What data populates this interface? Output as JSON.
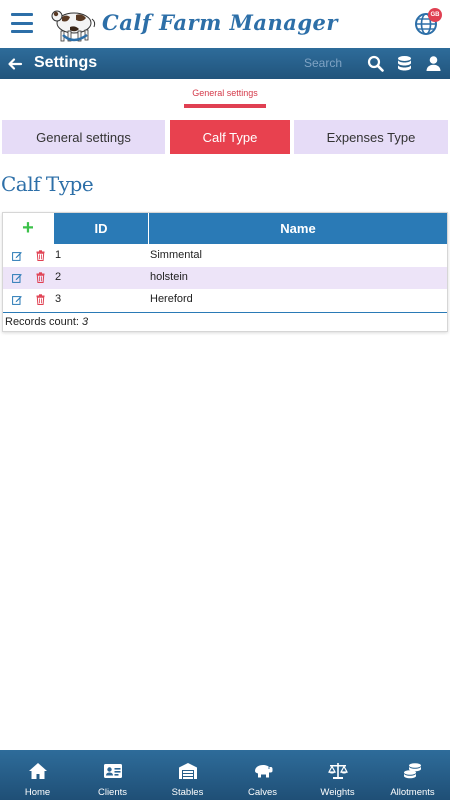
{
  "app": {
    "title": "Calf Farm Manager",
    "language_badge": "GB"
  },
  "header": {
    "title": "Settings",
    "search_placeholder": "Search"
  },
  "breadcrumb": {
    "label": "General settings"
  },
  "tabs": [
    {
      "label": "General settings",
      "active": false
    },
    {
      "label": "Calf Type",
      "active": true
    },
    {
      "label": "Expenses Type",
      "active": false
    }
  ],
  "page": {
    "heading": "Calf Type"
  },
  "table": {
    "add_symbol": "+",
    "columns": [
      "ID",
      "Name"
    ],
    "rows": [
      {
        "id": "1",
        "name": "Simmental"
      },
      {
        "id": "2",
        "name": "holstein"
      },
      {
        "id": "3",
        "name": "Hereford"
      }
    ],
    "footer_label": "Records count:",
    "footer_count": "3"
  },
  "bottom_nav": [
    {
      "label": "Home",
      "icon": "home-icon"
    },
    {
      "label": "Clients",
      "icon": "id-card-icon"
    },
    {
      "label": "Stables",
      "icon": "warehouse-icon"
    },
    {
      "label": "Calves",
      "icon": "hippo-icon"
    },
    {
      "label": "Weights",
      "icon": "scale-icon"
    },
    {
      "label": "Allotments",
      "icon": "coins-icon"
    }
  ],
  "colors": {
    "brand_blue": "#2d6fa8",
    "header_blue": "#2a6594",
    "accent_red": "#e8414f",
    "tab_lavender": "#e6dcf7",
    "table_header": "#2a7ab6",
    "add_green": "#3cc14a"
  }
}
